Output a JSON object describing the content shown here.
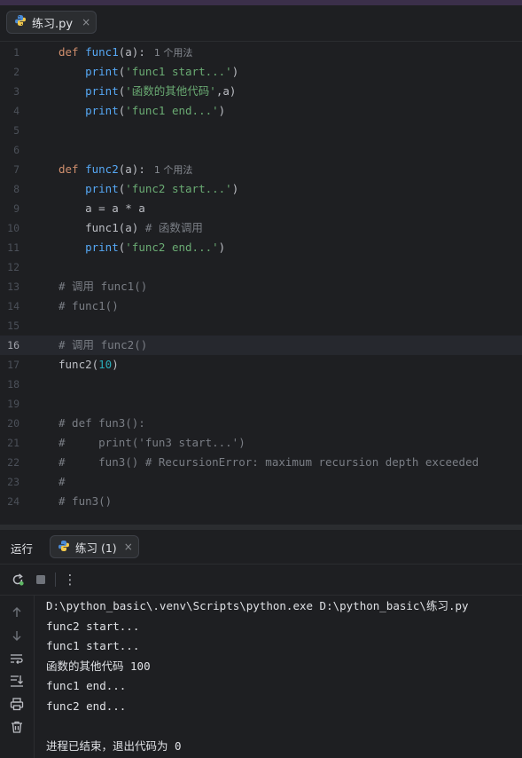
{
  "file_tab": {
    "name": "练习.py",
    "close": "×"
  },
  "editor": {
    "hint_text": "1 个用法",
    "lines": [
      {
        "n": "1",
        "tokens": [
          [
            "kw",
            "def "
          ],
          [
            "fn",
            "func1"
          ],
          [
            "plain",
            "(a):"
          ]
        ],
        "hint": true
      },
      {
        "n": "2",
        "tokens": [
          [
            "plain",
            "    "
          ],
          [
            "fn",
            "print"
          ],
          [
            "plain",
            "("
          ],
          [
            "str",
            "'func1 start...'"
          ],
          [
            "plain",
            ")"
          ]
        ]
      },
      {
        "n": "3",
        "tokens": [
          [
            "plain",
            "    "
          ],
          [
            "fn",
            "print"
          ],
          [
            "plain",
            "("
          ],
          [
            "str",
            "'函数的其他代码'"
          ],
          [
            "plain",
            ",a)"
          ]
        ]
      },
      {
        "n": "4",
        "tokens": [
          [
            "plain",
            "    "
          ],
          [
            "fn",
            "print"
          ],
          [
            "plain",
            "("
          ],
          [
            "str",
            "'func1 end...'"
          ],
          [
            "plain",
            ")"
          ]
        ]
      },
      {
        "n": "5",
        "tokens": []
      },
      {
        "n": "6",
        "tokens": []
      },
      {
        "n": "7",
        "tokens": [
          [
            "kw",
            "def "
          ],
          [
            "fn",
            "func2"
          ],
          [
            "plain",
            "(a):"
          ]
        ],
        "hint": true
      },
      {
        "n": "8",
        "tokens": [
          [
            "plain",
            "    "
          ],
          [
            "fn",
            "print"
          ],
          [
            "plain",
            "("
          ],
          [
            "str",
            "'func2 start...'"
          ],
          [
            "plain",
            ")"
          ]
        ]
      },
      {
        "n": "9",
        "tokens": [
          [
            "plain",
            "    a = a * a"
          ]
        ]
      },
      {
        "n": "10",
        "tokens": [
          [
            "plain",
            "    func1(a) "
          ],
          [
            "cmt",
            "# 函数调用"
          ]
        ]
      },
      {
        "n": "11",
        "tokens": [
          [
            "plain",
            "    "
          ],
          [
            "fn",
            "print"
          ],
          [
            "plain",
            "("
          ],
          [
            "str",
            "'func2 end...'"
          ],
          [
            "plain",
            ")"
          ]
        ]
      },
      {
        "n": "12",
        "tokens": []
      },
      {
        "n": "13",
        "tokens": [
          [
            "cmt",
            "# 调用 func1()"
          ]
        ]
      },
      {
        "n": "14",
        "tokens": [
          [
            "cmt",
            "# func1()"
          ]
        ]
      },
      {
        "n": "15",
        "tokens": []
      },
      {
        "n": "16",
        "tokens": [
          [
            "cmt",
            "# 调用 func2()"
          ]
        ],
        "current": true
      },
      {
        "n": "17",
        "tokens": [
          [
            "plain",
            "func2("
          ],
          [
            "num",
            "10"
          ],
          [
            "plain",
            ")"
          ]
        ]
      },
      {
        "n": "18",
        "tokens": []
      },
      {
        "n": "19",
        "tokens": []
      },
      {
        "n": "20",
        "tokens": [
          [
            "cmt",
            "# def fun3():"
          ]
        ]
      },
      {
        "n": "21",
        "tokens": [
          [
            "cmt",
            "#     print('fun3 start...')"
          ]
        ]
      },
      {
        "n": "22",
        "tokens": [
          [
            "cmt",
            "#     fun3() # RecursionError: maximum recursion depth exceeded"
          ]
        ]
      },
      {
        "n": "23",
        "tokens": [
          [
            "cmt",
            "#"
          ]
        ]
      },
      {
        "n": "24",
        "tokens": [
          [
            "cmt",
            "# fun3()"
          ]
        ]
      }
    ]
  },
  "run_panel": {
    "label": "运行",
    "tab": "练习 (1)",
    "tab_close": "×",
    "more": "⋮"
  },
  "console": {
    "lines": [
      "D:\\python_basic\\.venv\\Scripts\\python.exe D:\\python_basic\\练习.py",
      "func2 start...",
      "func1 start...",
      "函数的其他代码 100",
      "func1 end...",
      "func2 end...",
      "",
      "进程已结束，退出代码为 0"
    ]
  },
  "colors": {
    "keyword": "#cf8e6d",
    "function": "#56a8f5",
    "string": "#6aab73",
    "number": "#2aacb8",
    "comment": "#7a7e85"
  },
  "icons": [
    "python-icon",
    "rerun-icon",
    "stop-icon",
    "more-icon",
    "up-arrow-icon",
    "down-arrow-icon",
    "soft-wrap-icon",
    "scroll-to-end-icon",
    "print-icon",
    "trash-icon"
  ]
}
